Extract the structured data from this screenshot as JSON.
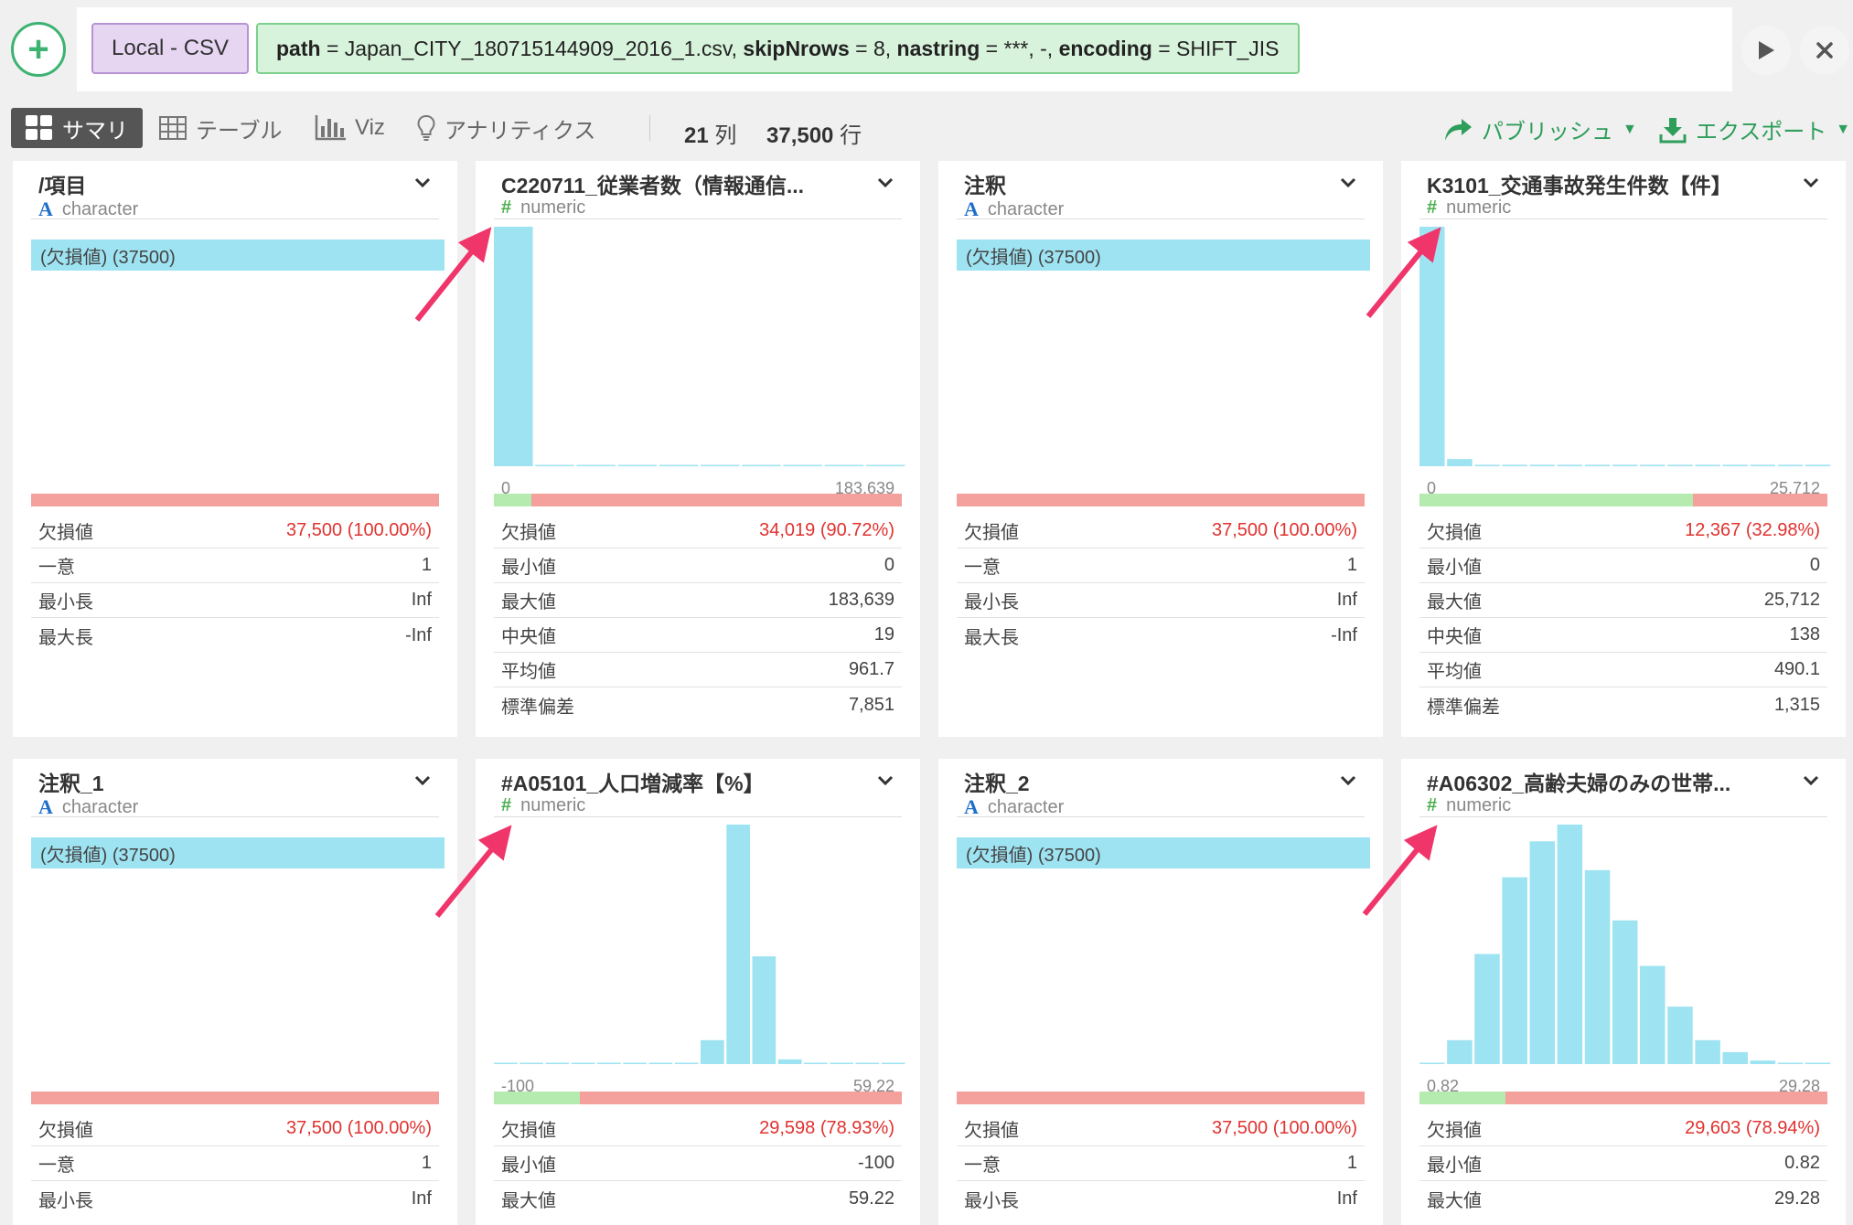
{
  "header": {
    "add_icon": "plus-icon",
    "source_chip": "Local - CSV",
    "params": [
      {
        "key": "path",
        "value": "Japan_CITY_180715144909_2016_1.csv"
      },
      {
        "key": "skipNrows",
        "value": "8"
      },
      {
        "key": "nastring",
        "value": "***, -"
      },
      {
        "key": "encoding",
        "value": "SHIFT_JIS"
      }
    ],
    "params_text": {
      "k0": "path",
      "v0": " = Japan_CITY_180715144909_2016_1.csv, ",
      "k1": "skipNrows",
      "v1": " = 8, ",
      "k2": "nastring",
      "v2": " = ***, -, ",
      "k3": "encoding",
      "v3": " = SHIFT_JIS"
    },
    "run_icon": "play-icon",
    "close_icon": "close-icon"
  },
  "viewbar": {
    "tabs": [
      {
        "label": "サマリ",
        "icon": "grid-icon",
        "active": true
      },
      {
        "label": "テーブル",
        "icon": "table-icon",
        "active": false
      },
      {
        "label": "Viz",
        "icon": "bar-chart-icon",
        "active": false
      },
      {
        "label": "アナリティクス",
        "icon": "lightbulb-icon",
        "active": false
      }
    ],
    "cols_count": "21",
    "cols_unit": "列",
    "rows_count": "37,500",
    "rows_unit": "行",
    "publish_label": "パブリッシュ",
    "export_label": "エクスポート"
  },
  "colors": {
    "bar": "#9ee3f2",
    "missing": "#f4a09c",
    "valid": "#b6ebb0",
    "accent": "#2e9e5b",
    "arrow": "#f0356b",
    "red_text": "#e0322f"
  },
  "cards": [
    {
      "name": "/項目",
      "type": "character",
      "missing_label": "(欠損値) (37500)",
      "valid_fraction": 0,
      "stats": [
        {
          "label": "欠損値",
          "value": "37,500 (100.00%)",
          "red": true
        },
        {
          "label": "一意",
          "value": "1"
        },
        {
          "label": "最小長",
          "value": "Inf"
        },
        {
          "label": "最大長",
          "value": "-Inf"
        }
      ]
    },
    {
      "name": "C220711_従業者数（情報通信...",
      "type": "numeric",
      "axis_min": "0",
      "axis_max": "183,639",
      "valid_fraction": 0.0928,
      "stats": [
        {
          "label": "欠損値",
          "value": "34,019 (90.72%)",
          "red": true
        },
        {
          "label": "最小値",
          "value": "0"
        },
        {
          "label": "最大値",
          "value": "183,639"
        },
        {
          "label": "中央値",
          "value": "19"
        },
        {
          "label": "平均値",
          "value": "961.7"
        },
        {
          "label": "標準偏差",
          "value": "7,851"
        }
      ]
    },
    {
      "name": "注釈",
      "type": "character",
      "missing_label": "(欠損値) (37500)",
      "valid_fraction": 0,
      "stats": [
        {
          "label": "欠損値",
          "value": "37,500 (100.00%)",
          "red": true
        },
        {
          "label": "一意",
          "value": "1"
        },
        {
          "label": "最小長",
          "value": "Inf"
        },
        {
          "label": "最大長",
          "value": "-Inf"
        }
      ]
    },
    {
      "name": "K3101_交通事故発生件数【件】",
      "type": "numeric",
      "axis_min": "0",
      "axis_max": "25,712",
      "valid_fraction": 0.6702,
      "stats": [
        {
          "label": "欠損値",
          "value": "12,367 (32.98%)",
          "red": true
        },
        {
          "label": "最小値",
          "value": "0"
        },
        {
          "label": "最大値",
          "value": "25,712"
        },
        {
          "label": "中央値",
          "value": "138"
        },
        {
          "label": "平均値",
          "value": "490.1"
        },
        {
          "label": "標準偏差",
          "value": "1,315"
        }
      ]
    },
    {
      "name": "注釈_1",
      "type": "character",
      "missing_label": "(欠損値) (37500)",
      "valid_fraction": 0,
      "stats": [
        {
          "label": "欠損値",
          "value": "37,500 (100.00%)",
          "red": true
        },
        {
          "label": "一意",
          "value": "1"
        },
        {
          "label": "最小長",
          "value": "Inf"
        }
      ]
    },
    {
      "name": "#A05101_人口増減率【%】",
      "type": "numeric",
      "axis_min": "-100",
      "axis_max": "59.22",
      "valid_fraction": 0.2107,
      "stats": [
        {
          "label": "欠損値",
          "value": "29,598 (78.93%)",
          "red": true
        },
        {
          "label": "最小値",
          "value": "-100"
        },
        {
          "label": "最大値",
          "value": "59.22"
        }
      ]
    },
    {
      "name": "注釈_2",
      "type": "character",
      "missing_label": "(欠損値) (37500)",
      "valid_fraction": 0,
      "stats": [
        {
          "label": "欠損値",
          "value": "37,500 (100.00%)",
          "red": true
        },
        {
          "label": "一意",
          "value": "1"
        },
        {
          "label": "最小長",
          "value": "Inf"
        }
      ]
    },
    {
      "name": "#A06302_高齢夫婦のみの世帯...",
      "type": "numeric",
      "axis_min": "0.82",
      "axis_max": "29.28",
      "valid_fraction": 0.2106,
      "stats": [
        {
          "label": "欠損値",
          "value": "29,603 (78.94%)",
          "red": true
        },
        {
          "label": "最小値",
          "value": "0.82"
        },
        {
          "label": "最大値",
          "value": "29.28"
        }
      ]
    }
  ],
  "chart_data": [
    {
      "type": "bar",
      "card": 1,
      "x_range": [
        0,
        183639
      ],
      "bin_heights_relative": [
        1.0,
        0.005,
        0.005,
        0.005,
        0.005,
        0.005,
        0.005,
        0.005,
        0.005,
        0.005
      ]
    },
    {
      "type": "bar",
      "card": 3,
      "x_range": [
        0,
        25712
      ],
      "bin_heights_relative": [
        1.0,
        0.03,
        0.006,
        0.006,
        0.006,
        0.006,
        0.006,
        0.006,
        0.006,
        0.006,
        0.006,
        0.006,
        0.006,
        0.006,
        0.006
      ]
    },
    {
      "type": "bar",
      "card": 5,
      "x_range": [
        -100,
        59.22
      ],
      "bin_heights_relative": [
        0.005,
        0.005,
        0.005,
        0.005,
        0.005,
        0.005,
        0.005,
        0.005,
        0.1,
        1.0,
        0.45,
        0.02,
        0.005,
        0.005,
        0.005,
        0.005
      ]
    },
    {
      "type": "bar",
      "card": 7,
      "x_range": [
        0.82,
        29.28
      ],
      "bin_heights_relative": [
        0.005,
        0.1,
        0.46,
        0.78,
        0.93,
        1.0,
        0.81,
        0.6,
        0.41,
        0.24,
        0.1,
        0.05,
        0.015,
        0.005,
        0.005
      ]
    }
  ]
}
